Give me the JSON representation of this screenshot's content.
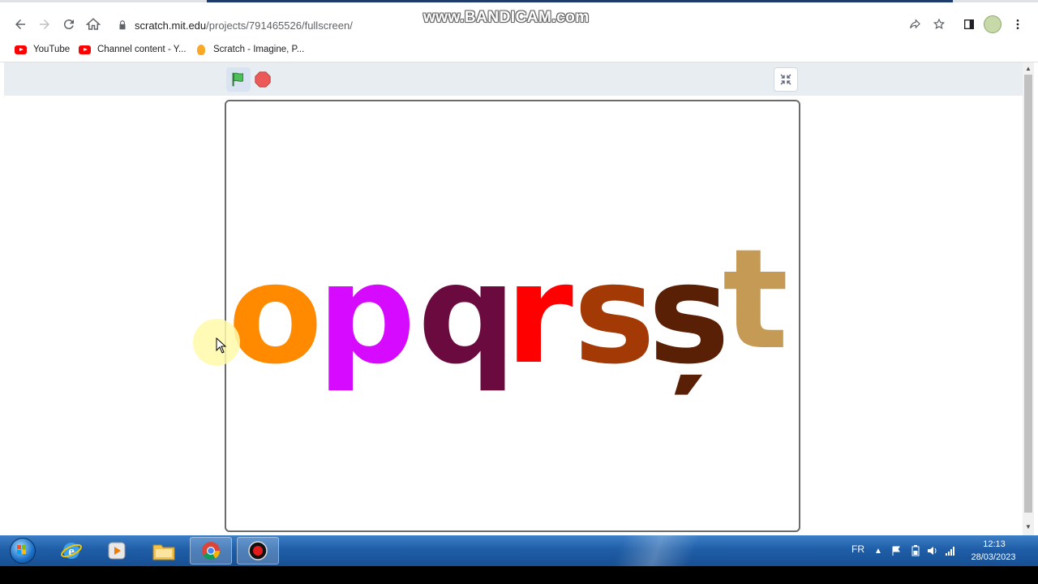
{
  "browser": {
    "url_host": "scratch.mit.edu",
    "url_path": "/projects/791465526/fullscreen/",
    "watermark": "www.BANDICAM.com"
  },
  "bookmarks": [
    {
      "label": "YouTube",
      "icon": "youtube-icon"
    },
    {
      "label": "Channel content - Y...",
      "icon": "youtube-icon"
    },
    {
      "label": "Scratch - Imagine, P...",
      "icon": "scratch-icon"
    }
  ],
  "stage": {
    "letters": [
      {
        "char": "o",
        "color": "#ff8a00"
      },
      {
        "char": "p",
        "color": "#d60aff"
      },
      {
        "char": "q",
        "color": "#6b0a3f"
      },
      {
        "char": "r",
        "color": "#ff0000"
      },
      {
        "char": "s",
        "color": "#a33a05"
      },
      {
        "char": "ș",
        "color": "#5a2005"
      },
      {
        "char": "t",
        "color": "#c59a55"
      }
    ]
  },
  "taskbar": {
    "language": "FR",
    "time": "12:13",
    "date": "28/03/2023"
  }
}
